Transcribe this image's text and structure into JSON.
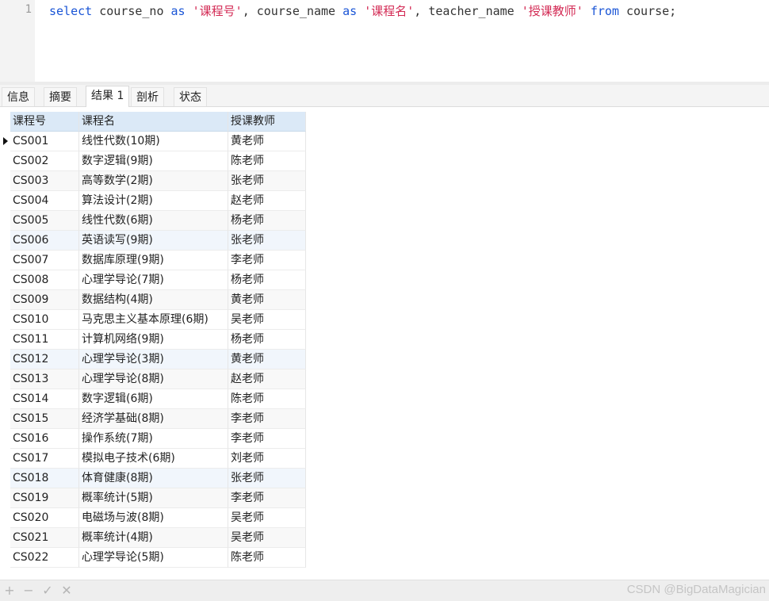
{
  "editor": {
    "line_number": "1",
    "tokens": [
      {
        "t": "select",
        "c": "kw"
      },
      {
        "t": " course_no ",
        "c": ""
      },
      {
        "t": "as",
        "c": "kw"
      },
      {
        "t": " ",
        "c": ""
      },
      {
        "t": "'课程号'",
        "c": "str"
      },
      {
        "t": ", course_name ",
        "c": ""
      },
      {
        "t": "as",
        "c": "kw"
      },
      {
        "t": " ",
        "c": ""
      },
      {
        "t": "'课程名'",
        "c": "str"
      },
      {
        "t": ", teacher_name ",
        "c": ""
      },
      {
        "t": "'授课教师'",
        "c": "str"
      },
      {
        "t": " ",
        "c": ""
      },
      {
        "t": "from",
        "c": "kw"
      },
      {
        "t": " course;",
        "c": ""
      }
    ]
  },
  "tabs": {
    "info": "信息",
    "summary": "摘要",
    "result": "结果 1",
    "profile": "剖析",
    "status": "状态"
  },
  "grid": {
    "headers": [
      "课程号",
      "课程名",
      "授课教师"
    ],
    "rows": [
      [
        "CS001",
        "线性代数(10期)",
        "黄老师"
      ],
      [
        "CS002",
        "数字逻辑(9期)",
        "陈老师"
      ],
      [
        "CS003",
        "高等数学(2期)",
        "张老师"
      ],
      [
        "CS004",
        "算法设计(2期)",
        "赵老师"
      ],
      [
        "CS005",
        "线性代数(6期)",
        "杨老师"
      ],
      [
        "CS006",
        "英语读写(9期)",
        "张老师"
      ],
      [
        "CS007",
        "数据库原理(9期)",
        "李老师"
      ],
      [
        "CS008",
        "心理学导论(7期)",
        "杨老师"
      ],
      [
        "CS009",
        "数据结构(4期)",
        "黄老师"
      ],
      [
        "CS010",
        "马克思主义基本原理(6期)",
        "吴老师"
      ],
      [
        "CS011",
        "计算机网络(9期)",
        "杨老师"
      ],
      [
        "CS012",
        "心理学导论(3期)",
        "黄老师"
      ],
      [
        "CS013",
        "心理学导论(8期)",
        "赵老师"
      ],
      [
        "CS014",
        "数字逻辑(6期)",
        "陈老师"
      ],
      [
        "CS015",
        "经济学基础(8期)",
        "李老师"
      ],
      [
        "CS016",
        "操作系统(7期)",
        "李老师"
      ],
      [
        "CS017",
        "模拟电子技术(6期)",
        "刘老师"
      ],
      [
        "CS018",
        "体育健康(8期)",
        "张老师"
      ],
      [
        "CS019",
        "概率统计(5期)",
        "李老师"
      ],
      [
        "CS020",
        "电磁场与波(8期)",
        "吴老师"
      ],
      [
        "CS021",
        "概率统计(4期)",
        "吴老师"
      ],
      [
        "CS022",
        "心理学导论(5期)",
        "陈老师"
      ]
    ]
  },
  "statusbar": {
    "icons": [
      "plus-icon",
      "minus-icon",
      "check-icon",
      "close-icon"
    ],
    "glyphs": [
      "+",
      "−",
      "✓",
      "✕"
    ],
    "watermark": "CSDN @BigDataMagician"
  }
}
